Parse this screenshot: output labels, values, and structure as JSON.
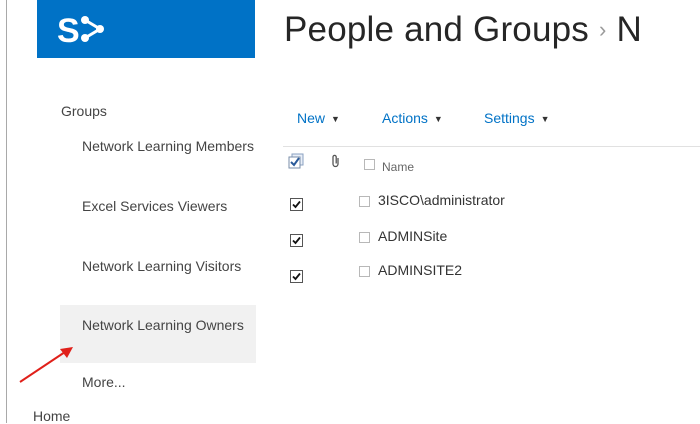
{
  "header": {
    "logo_icon": "sharepoint-logo-icon",
    "title": "People and Groups",
    "separator": "›",
    "title_continuation": "N"
  },
  "sidebar": {
    "heading": "Groups",
    "items": [
      {
        "label": "Network Learning Members",
        "selected": false
      },
      {
        "label": "Excel Services Viewers",
        "selected": false
      },
      {
        "label": "Network Learning Visitors",
        "selected": false
      },
      {
        "label": "Network Learning Owners",
        "selected": true
      },
      {
        "label": "More...",
        "selected": false
      }
    ],
    "home": "Home"
  },
  "toolbar": {
    "new_label": "New",
    "actions_label": "Actions",
    "settings_label": "Settings"
  },
  "list": {
    "columns": {
      "select_all_icon": "select-all-checkbox-icon",
      "attachment_icon": "paperclip-icon",
      "name": "Name"
    },
    "rows": [
      {
        "name": "3ISCO\\administrator",
        "checked": true
      },
      {
        "name": "ADMINSite",
        "checked": true
      },
      {
        "name": "ADMINSITE2",
        "checked": true
      }
    ]
  },
  "annotation": {
    "icon": "red-arrow-icon",
    "color": "#e0201a"
  },
  "colors": {
    "brand": "#0072c6",
    "selected_bg": "#f1f1f1"
  }
}
